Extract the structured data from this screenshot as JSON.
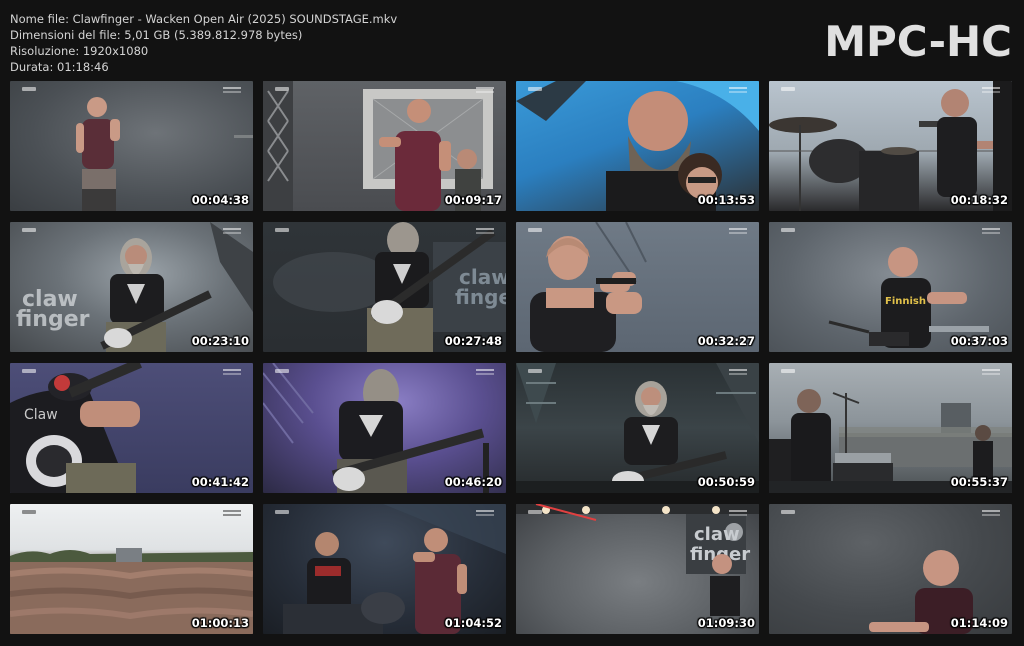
{
  "file_info": {
    "name_line": "Nome file: Clawfinger - Wacken Open Air (2025) SOUNDSTAGE.mkv",
    "size_line": "Dimensioni del file: 5,01 GB (5.389.812.978 bytes)",
    "resolution_line": "Risoluzione: 1920x1080",
    "duration_line": "Durata: 01:18:46"
  },
  "logo": "MPC-HC",
  "thumbnails": [
    {
      "time": "00:04:38",
      "scene": "singer-grey-stage"
    },
    {
      "time": "00:09:17",
      "scene": "singer-speaker-stack"
    },
    {
      "time": "00:13:53",
      "scene": "crowd-closeup-blue-balloon"
    },
    {
      "time": "00:18:32",
      "scene": "drummer-kit-sky"
    },
    {
      "time": "00:23:10",
      "scene": "bassist-smoke-logo"
    },
    {
      "time": "00:27:48",
      "scene": "bassist-dark-screen"
    },
    {
      "time": "00:32:27",
      "scene": "singer-bald-blue"
    },
    {
      "time": "00:37:03",
      "scene": "keyboardist-grey"
    },
    {
      "time": "00:41:42",
      "scene": "bass-closeup-purple"
    },
    {
      "time": "00:46:20",
      "scene": "bassist-purple-lights"
    },
    {
      "time": "00:50:59",
      "scene": "bassist-wide-stage"
    },
    {
      "time": "00:55:37",
      "scene": "stage-side-crowd"
    },
    {
      "time": "01:00:13",
      "scene": "huge-crowd-sky"
    },
    {
      "time": "01:04:52",
      "scene": "band-wide-dark"
    },
    {
      "time": "01:09:30",
      "scene": "stage-smoke-lights"
    },
    {
      "time": "01:14:09",
      "scene": "singer-dark-grey"
    }
  ]
}
